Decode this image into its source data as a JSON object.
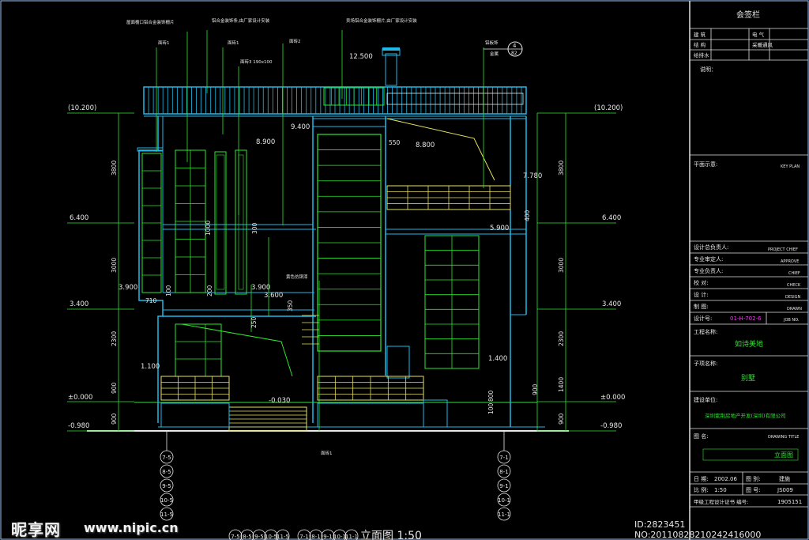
{
  "drawing_title": "立面图 1:50",
  "title_block": {
    "header": "会签栏",
    "signoff_rows": [
      [
        "建 筑",
        "电 气"
      ],
      [
        "结 构",
        "采暖通风"
      ],
      [
        "给排水",
        ""
      ]
    ],
    "notes_label": "说明：",
    "key_plan_label": "平面示意:",
    "key_plan_en": "KEY PLAN",
    "roles": [
      {
        "cn": "设计总负责人:",
        "en": "PROJECT CHIEF"
      },
      {
        "cn": "专业审定人:",
        "en": "APPROVE"
      },
      {
        "cn": "专业负责人:",
        "en": "CHIEF"
      },
      {
        "cn": "校 对:",
        "en": "CHECK"
      },
      {
        "cn": "设 计:",
        "en": "DESIGN"
      },
      {
        "cn": "制 图:",
        "en": "DRAWN"
      },
      {
        "cn": "设计号:",
        "en": "JOB NO.",
        "value": "01-H-702-6"
      }
    ],
    "project_name_label": "工程名称:",
    "project_name": "如诗美地",
    "subproject_label": "子项名称:",
    "subproject": "别墅",
    "client_label": "建设单位:",
    "client": "深圳紫荆房地产开发(深圳)有限公司",
    "drawing_name_label": "图 名:",
    "drawing_name_en": "DRAWING TITLE",
    "drawing_name": "立面图",
    "date_label": "日 期:",
    "date": "2002.06",
    "discipline_label": "图 别:",
    "discipline": "建施",
    "scale_label": "比 例:",
    "scale": "1:50",
    "sheet_label": "图 号:",
    "sheet": "JS009",
    "cert_label": "甲级工程设计证书 编号:",
    "cert": "1905151"
  },
  "elevation_marks": {
    "left": [
      "(10.200)",
      "6.400",
      "3.900",
      "3.400",
      "±0.000",
      "-0.980"
    ],
    "right": [
      "(10.200)",
      "6.400",
      "3.400",
      "±0.000",
      "-0.980"
    ],
    "interior": [
      "12.500",
      "9.400",
      "8.900",
      "8.800",
      "7.780",
      "5.900",
      "3.900",
      "3.600",
      "1.400",
      "1.100",
      "-0.030"
    ]
  },
  "dimensions": {
    "left": [
      "3800",
      "3000",
      "2300",
      "900",
      "900"
    ],
    "right": [
      "3800",
      "3000",
      "2300",
      "1400",
      "900",
      "900"
    ],
    "misc": [
      "550",
      "400",
      "710",
      "1000",
      "300",
      "350",
      "100",
      "200",
      "250",
      "100",
      "800"
    ]
  },
  "annotations": [
    "屋面檐口铝合金装饰栅片",
    "铝合金装饰条,由厂家设计安装",
    "面砖1",
    "面砖2",
    "面砖3 190x100",
    "卖场铝合金装饰栅片,由厂家设计安装",
    "铝板饰",
    "金属",
    "黄色仿铜漆",
    "面砖1"
  ],
  "detail_tag": {
    "num": "4",
    "sheet": "82"
  },
  "axis_left": [
    "7-5",
    "8-5",
    "9-5",
    "10-5",
    "11-5"
  ],
  "axis_right": [
    "7-1",
    "8-1",
    "9-1",
    "10-1",
    "11-1"
  ],
  "axis_bottom": [
    "7-5",
    "8-5",
    "9-5",
    "10-5",
    "11-5",
    "7-1",
    "8-1",
    "9-1",
    "10-1",
    "11-1"
  ],
  "watermark": {
    "brand": "昵享网",
    "site": "www.nipic.cn",
    "id": "ID:2823451 NO:20110828210242416000"
  },
  "colors": {
    "green": "#2ee62e",
    "cyan": "#22b8e8",
    "yellow": "#e8e060",
    "magenta": "#e040e0",
    "frame": "#9ac8ff"
  }
}
